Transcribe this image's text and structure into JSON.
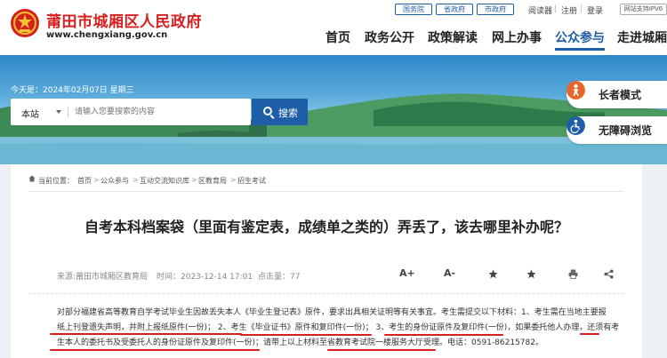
{
  "header": {
    "site_name": "莆田市城厢区人民政府",
    "site_url": "www.chengxiang.gov.cn",
    "gov_links": [
      "国务院",
      "省政府",
      "市政府"
    ],
    "top_links": [
      "阅读器",
      "注册",
      "登录"
    ],
    "ipv6": "网站支持IPV6"
  },
  "nav": [
    "首页",
    "政务公开",
    "政策解读",
    "网上办事",
    "公众参与",
    "走进城厢"
  ],
  "nav_active": "公众参与",
  "banner": {
    "date": "今天是：2024年02月07日 星期三",
    "scope": "本站",
    "placeholder": "请输入您要搜索的内容",
    "search_label": "搜索",
    "elder_mode": "长者模式",
    "accessible": "无障碍浏览"
  },
  "breadcrumb": {
    "prefix": "当前位置：",
    "items": [
      "首页",
      "公众参与",
      "互动交流知识库",
      "区教育局",
      "招生考试"
    ]
  },
  "article": {
    "title": "自考本科档案袋（里面有鉴定表，成绩单之类的）弄丢了，该去哪里补办呢？",
    "source": "来源:莆田市城厢区教育局",
    "time": "时间：2023-12-14 17:01",
    "views": "点击量：77",
    "tools": [
      "A+",
      "A-"
    ],
    "para_line1": "对部分福建省高等教育自学考试毕业生因故丢失本人《毕业生登记表》原件，要求出具相关证明等有关事宜。考生需提交以下材料：1、考生需在当地主要报",
    "para_line2": "纸上刊登遗失声明，并附上报纸原件(一份)；  2、考生《毕业证书》原件和复印件(一份)；  3、考生的身份证原件及复印件(一份)，如果委托他人办理，还须有考",
    "para_line3": "生本人的委托书及受委托人的身份证原件及复印件(一份)；请带上以上材料至省教育考试院一楼服务大厅受理。电话：0591-86215782。"
  },
  "colors": {
    "brand_red": "#d6201f",
    "nav_blue": "#1e5ea8",
    "elder_icon": "#e7672a",
    "access_icon": "#1e5ea8"
  }
}
